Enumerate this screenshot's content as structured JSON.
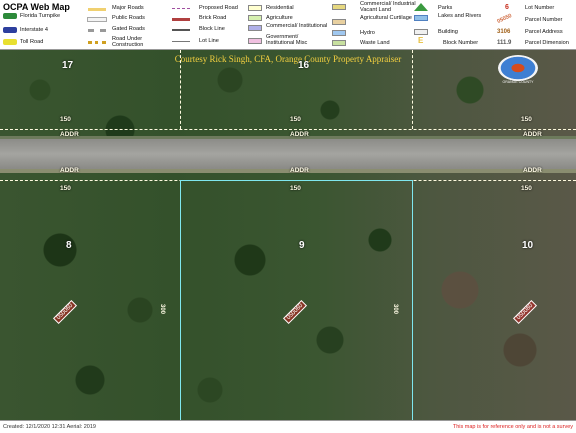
{
  "legend": {
    "title": "OCPA Web Map",
    "items": [
      {
        "label": "Florida Turnpike"
      },
      {
        "label": "Interstate 4"
      },
      {
        "label": "Toll Road"
      },
      {
        "label": "Major Roads"
      },
      {
        "label": "Public Roads"
      },
      {
        "label": "Gated Roads"
      },
      {
        "label": "Road Under Construction"
      },
      {
        "label": "Proposed Road"
      },
      {
        "label": "Brick Road"
      },
      {
        "label": "Block Line"
      },
      {
        "label": "Lot Line"
      },
      {
        "label": "Residential"
      },
      {
        "label": "Agriculture"
      },
      {
        "label": "Commercial/ Institutional"
      },
      {
        "label": "Government/ Institutional Misc"
      },
      {
        "label": "Commercial/ Industrial Vacant Land"
      },
      {
        "label": "Agricultural Curtilage"
      },
      {
        "label": "Hydro"
      },
      {
        "label": "Waste Land"
      },
      {
        "label": "Parks"
      },
      {
        "label": "Lakes and Rivers"
      },
      {
        "label": "Building"
      },
      {
        "label": "Block Number"
      },
      {
        "label": "Lot Number"
      },
      {
        "label": "Parcel Number"
      },
      {
        "label": "Parcel Address"
      },
      {
        "label": "Parcel Dimension"
      }
    ],
    "sample_lot": "6",
    "sample_parcel": "05050",
    "sample_address": "3106",
    "sample_dimension": "111.9",
    "sample_block": "E",
    "colors": {
      "residential": "#ffffd0",
      "agriculture": "#d6f0b0",
      "commercial": "#b0b0e8",
      "government": "#f0c0e0",
      "industrial": "#e6d880",
      "curtilage": "#e8d0a0",
      "hydro": "#a0c8f0",
      "waste": "#c8e0a0",
      "parks": "#60b060",
      "lakes": "#90c0e8",
      "building": "#f0f0f0"
    }
  },
  "map": {
    "credit": "Courtesy Rick Singh, CFA, Orange County Property Appraiser",
    "seal_text": "ORANGE COUNTY",
    "lots": {
      "lot_17": "17",
      "lot_16": "16",
      "lot_8": "8",
      "lot_9": "9",
      "lot_10": "10"
    },
    "dimensions": {
      "top_left": "150",
      "top_mid": "150",
      "top_right": "150",
      "bot_left": "150",
      "bot_mid": "150",
      "bot_right": "150",
      "side_left": "300",
      "side_right": "300"
    },
    "addresses": [
      "ADDR",
      "ADDR",
      "ADDR",
      "ADDR",
      "ADDR",
      "ADDR"
    ],
    "parcel_ids": [
      "050060",
      "050060",
      "050080"
    ]
  },
  "footer": {
    "left": "Created: 12/1/2020 12:31   Aerial: 2019",
    "right": "This map is for reference only and is not a survey"
  }
}
